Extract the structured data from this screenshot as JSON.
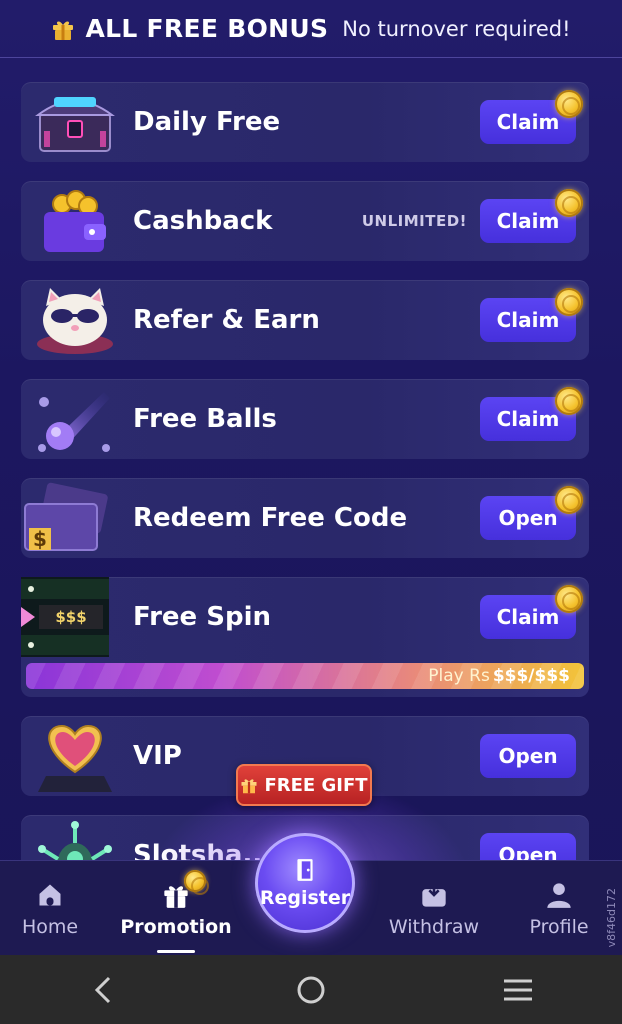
{
  "header": {
    "title": "ALL FREE BONUS",
    "subtitle": "No turnover required!"
  },
  "cards": [
    {
      "label": "Daily Free",
      "button": "Claim",
      "thumb": "treasure-chest-icon"
    },
    {
      "label": "Cashback",
      "note": "UNLIMITED!",
      "button": "Claim",
      "thumb": "wallet-coins-icon"
    },
    {
      "label": "Refer & Earn",
      "button": "Claim",
      "thumb": "cat-mascot-icon"
    },
    {
      "label": "Free Balls",
      "button": "Claim",
      "thumb": "comet-ball-icon"
    },
    {
      "label": "Redeem Free Code",
      "button": "Open",
      "thumb": "ticket-dollar-icon"
    },
    {
      "label": "Free Spin",
      "button": "Claim",
      "thumb": "slot-reel-icon",
      "reel_text": "$$$"
    },
    {
      "label": "VIP",
      "button": "Open",
      "thumb": "heart-badge-icon"
    },
    {
      "label": "Slotsha...",
      "button": "Open",
      "thumb": "alien-icon"
    }
  ],
  "free_spin_progress": {
    "prefix": "Play Rs",
    "value": "$$$/$$$"
  },
  "free_gift": {
    "label": "FREE GIFT"
  },
  "bottom_nav": {
    "items": [
      {
        "label": "Home",
        "icon": "home-icon"
      },
      {
        "label": "Promotion",
        "icon": "gift-icon",
        "active": true
      },
      {
        "label": "Withdraw",
        "icon": "wallet-withdraw-icon"
      },
      {
        "label": "Profile",
        "icon": "profile-icon"
      }
    ],
    "register_label": "Register"
  },
  "version": "v8f46d172",
  "colors": {
    "accent": "#4a33e0",
    "background": "#1c1758",
    "gift_red": "#c9302c",
    "coin_gold": "#f5c22c"
  }
}
